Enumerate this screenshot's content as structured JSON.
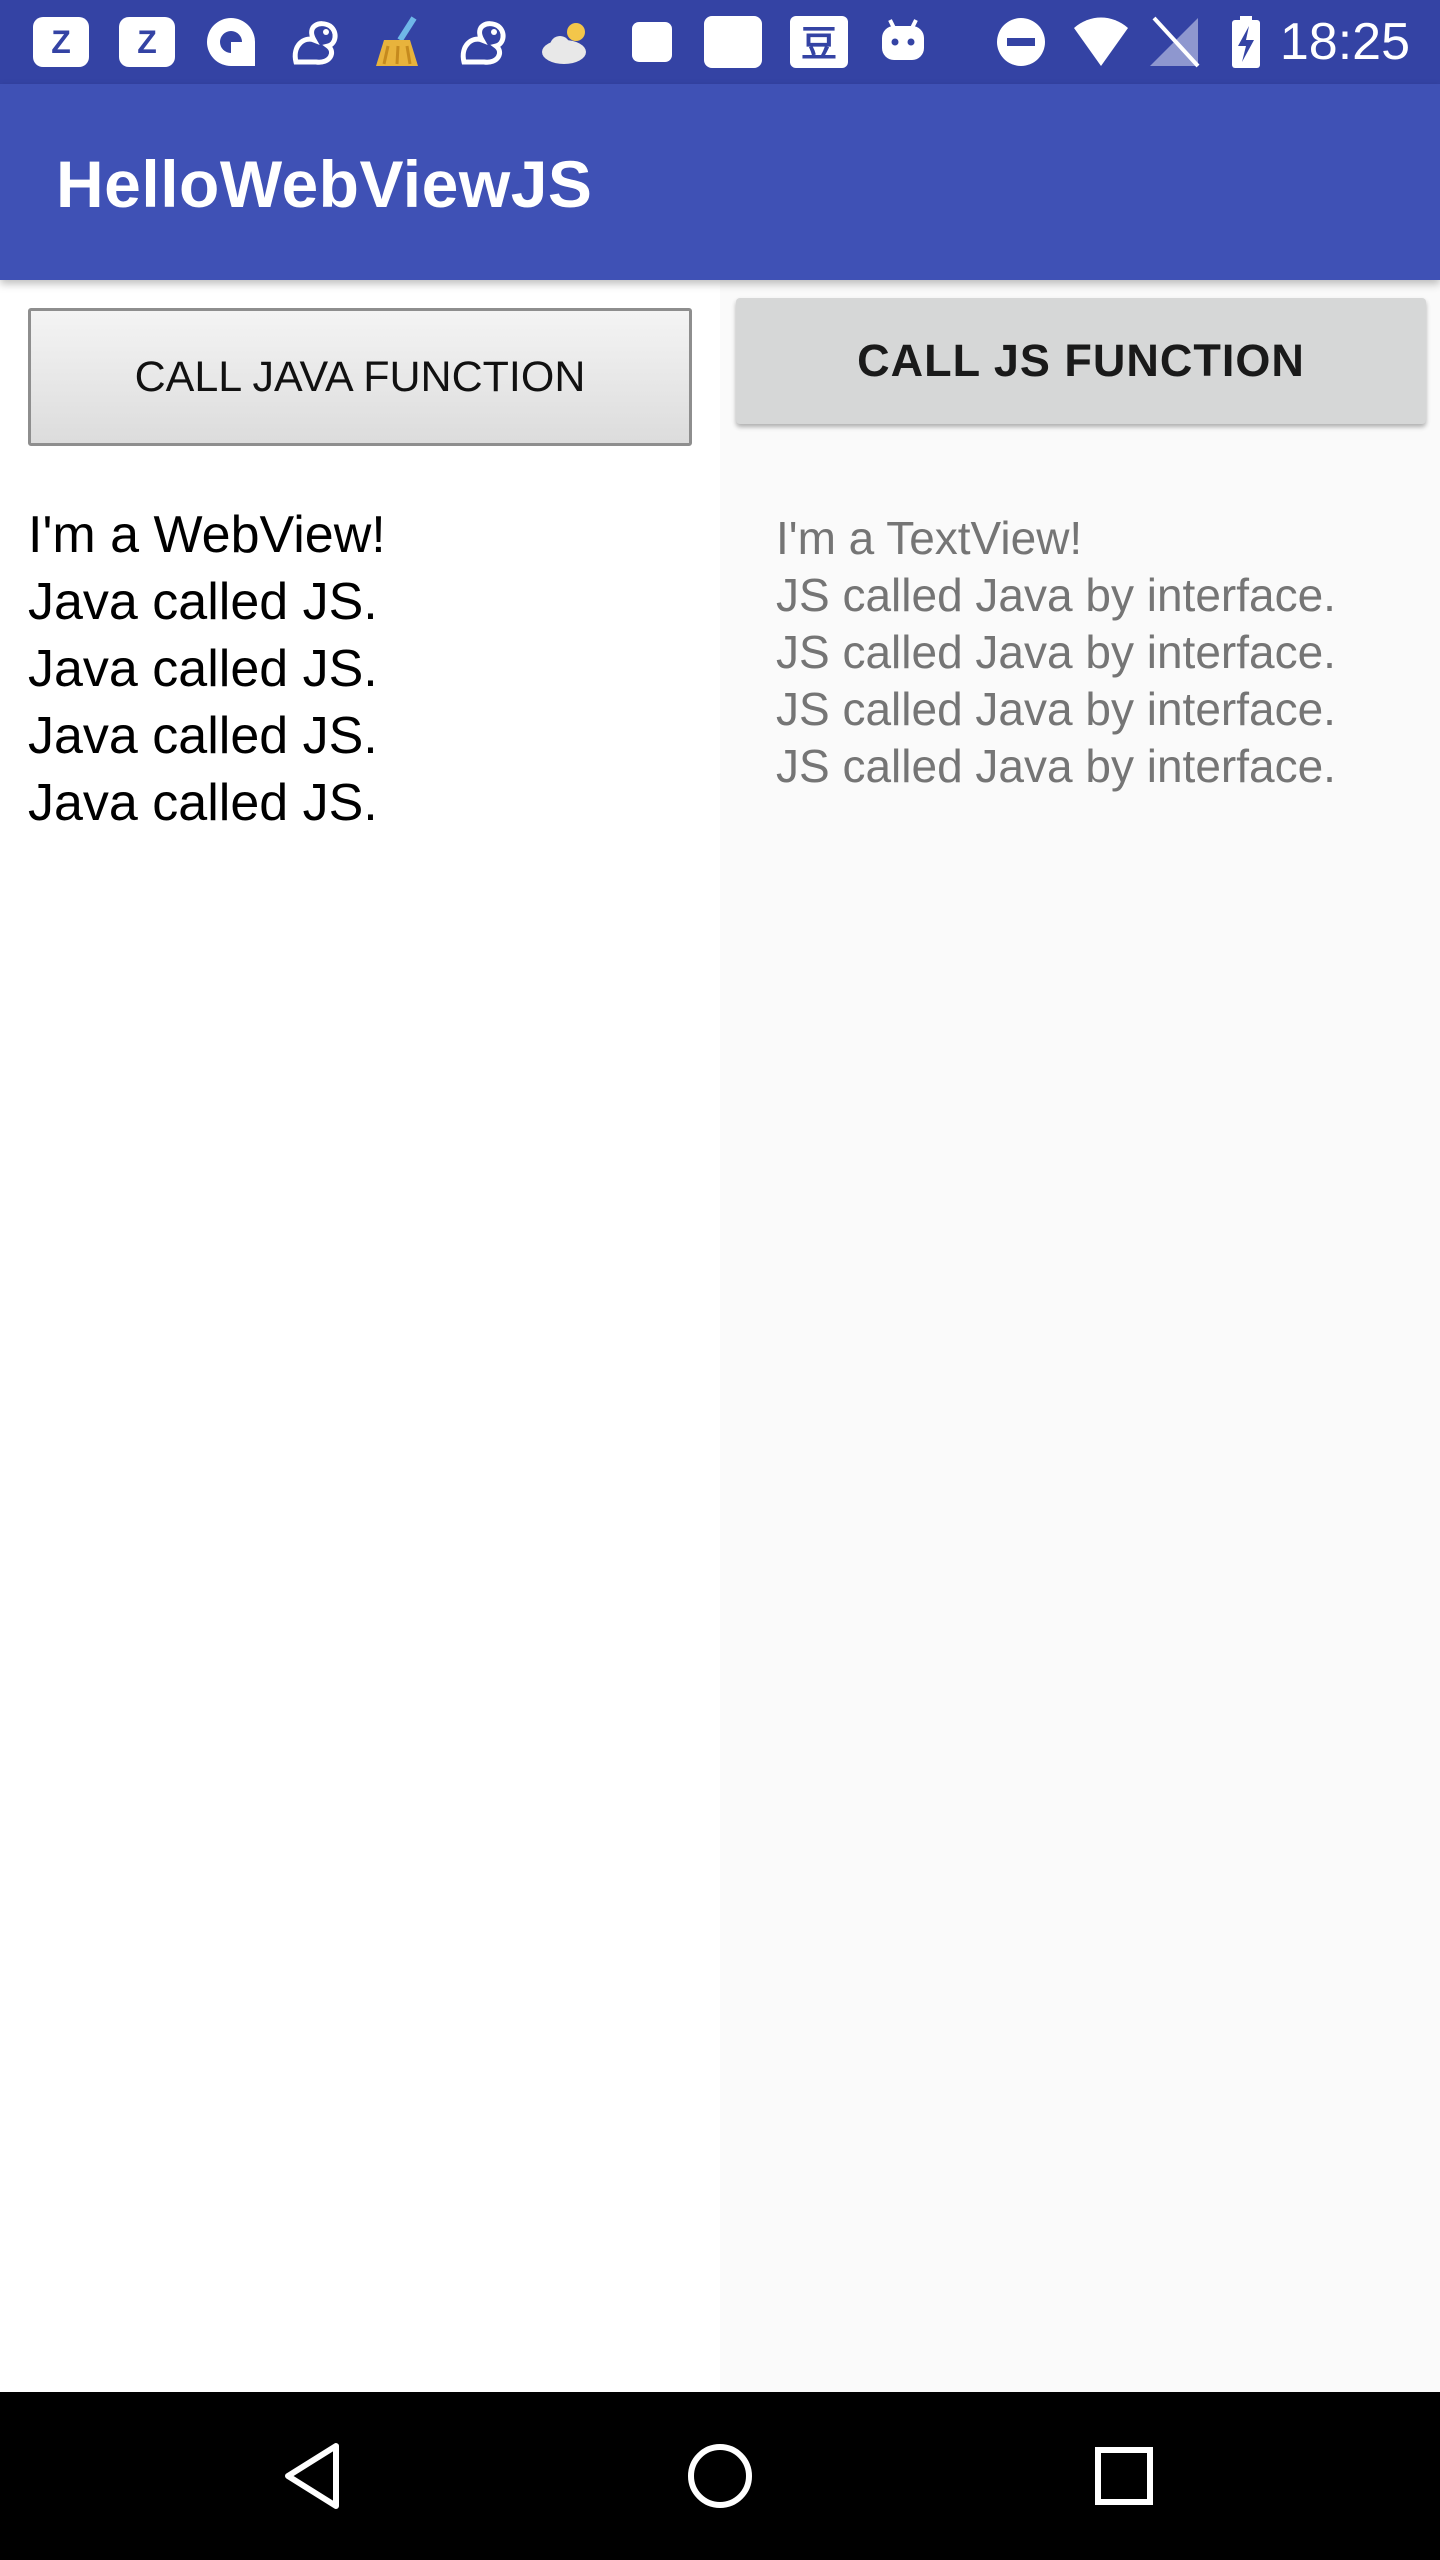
{
  "status_bar": {
    "time": "18:25",
    "notification_icons": [
      "z-app-icon",
      "z-app-icon",
      "browser-icon",
      "squirrel-icon",
      "broom-icon",
      "squirrel-icon",
      "weather-icon",
      "square-icon",
      "square-icon",
      "douban-icon",
      "android-icon"
    ],
    "system_icons": [
      "do-not-disturb-icon",
      "wifi-icon",
      "no-signal-icon",
      "battery-charging-icon"
    ]
  },
  "app_bar": {
    "title": "HelloWebViewJS"
  },
  "left_pane": {
    "button_label": "CALL JAVA FUNCTION",
    "webview_lines": [
      "I'm a WebView!",
      "Java called JS.",
      "Java called JS.",
      "Java called JS.",
      "Java called JS."
    ]
  },
  "right_pane": {
    "button_label": "CALL JS FUNCTION",
    "textview_lines": [
      "I'm a TextView!",
      "JS called Java by interface.",
      "JS called Java by interface.",
      "JS called Java by interface.",
      "JS called Java by interface."
    ]
  },
  "nav_bar": {
    "buttons": [
      "back-icon",
      "home-icon",
      "recents-icon"
    ]
  },
  "colors": {
    "status_bar": "#3443a4",
    "app_bar": "#3f51b5",
    "right_pane_bg": "#fafafa",
    "textview_text": "#757575"
  }
}
